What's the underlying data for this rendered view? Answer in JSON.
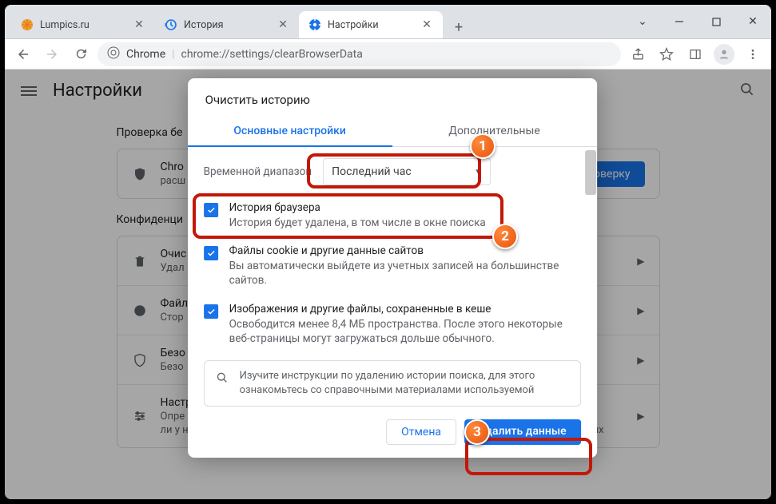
{
  "tabs": [
    {
      "title": "Lumpics.ru",
      "icon": "orange"
    },
    {
      "title": "История",
      "icon": "history"
    },
    {
      "title": "Настройки",
      "icon": "gear"
    }
  ],
  "omnibox": {
    "chrome": "Chrome",
    "url": "chrome://settings/clearBrowserData"
  },
  "settings": {
    "title": "Настройки",
    "section_check": "Проверка бе",
    "check_card_title": "Chro",
    "check_card_sub": "расш",
    "check_btn": "роверку",
    "section_priv": "Конфиденци",
    "rows": [
      {
        "title": "Очис",
        "sub": "Удал"
      },
      {
        "title": "Файл",
        "sub": "Стор"
      },
      {
        "title": "Безо",
        "sub": "Безо"
      },
      {
        "title": "Настр",
        "sub": "Опре",
        "sub2": "ли у них доступ к местоположению и камере, а также разрешение на показ всплывающих"
      }
    ]
  },
  "dialog": {
    "title": "Очистить историю",
    "tab_basic": "Основные настройки",
    "tab_advanced": "Дополнительные",
    "time_label": "Временной диапазон",
    "time_value": "Последний час",
    "items": [
      {
        "title": "История браузера",
        "sub": "История будет удалена, в том числе в окне поиска"
      },
      {
        "title": "Файлы cookie и другие данные сайтов",
        "sub": "Вы автоматически выйдете из учетных записей на большинстве сайтов."
      },
      {
        "title": "Изображения и другие файлы, сохраненные в кеше",
        "sub": "Освободится менее 8,4 МБ пространства. После этого некоторые веб-страницы могут загружаться дольше обычного."
      }
    ],
    "info": "Изучите инструкции по удалению истории поиска, для этого ознакомьтесь со справочными материалами используемой",
    "cancel": "Отмена",
    "delete": "Удалить данные"
  },
  "callouts": [
    "1",
    "2",
    "3"
  ]
}
